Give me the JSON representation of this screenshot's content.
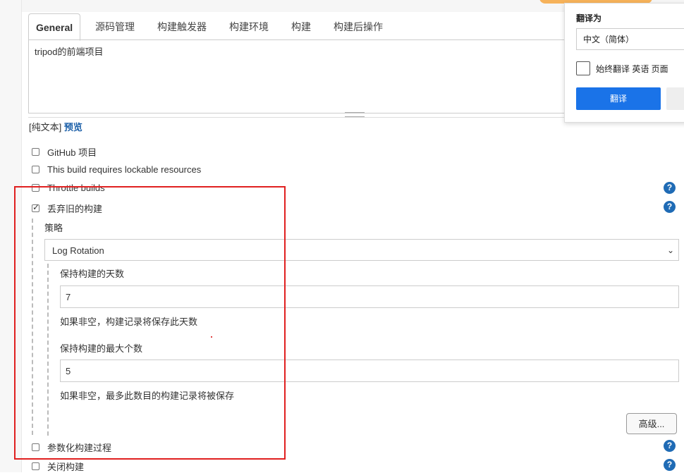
{
  "tabs": [
    {
      "label": "General"
    },
    {
      "label": "源码管理"
    },
    {
      "label": "构建触发器"
    },
    {
      "label": "构建环境"
    },
    {
      "label": "构建"
    },
    {
      "label": "构建后操作"
    }
  ],
  "description": {
    "value": "tripod的前端项目"
  },
  "preview": {
    "plain_text": "[纯文本]",
    "preview_link": "预览"
  },
  "options": {
    "github_project": {
      "label": "GitHub 项目",
      "checked": false
    },
    "lockable_resources": {
      "label": "This build requires lockable resources",
      "checked": false
    },
    "throttle_builds": {
      "label": "Throttle builds",
      "checked": false
    },
    "discard_old_builds": {
      "label": "丢弃旧的构建",
      "checked": true
    },
    "parameterized": {
      "label": "参数化构建过程",
      "checked": false
    },
    "disable_build": {
      "label": "关闭构建",
      "checked": false
    }
  },
  "strategy": {
    "label": "策略",
    "selected": "Log Rotation"
  },
  "days_to_keep": {
    "label": "保持构建的天数",
    "value": "7",
    "hint": "如果非空，构建记录将保存此天数"
  },
  "max_builds": {
    "label": "保持构建的最大个数",
    "value": "5",
    "hint": "如果非空，最多此数目的构建记录将被保存"
  },
  "advanced_button": "高级...",
  "help_icon_glyph": "?",
  "translate_popup": {
    "title": "翻译为",
    "language": "中文（简体）",
    "always_translate": "始终翻译 英语 页面",
    "translate_button": "翻译"
  },
  "colors": {
    "accent": "#1f6bb5",
    "link": "#1b5fa8",
    "highlight_box": "#e02020",
    "translate_button": "#1a73e8"
  }
}
